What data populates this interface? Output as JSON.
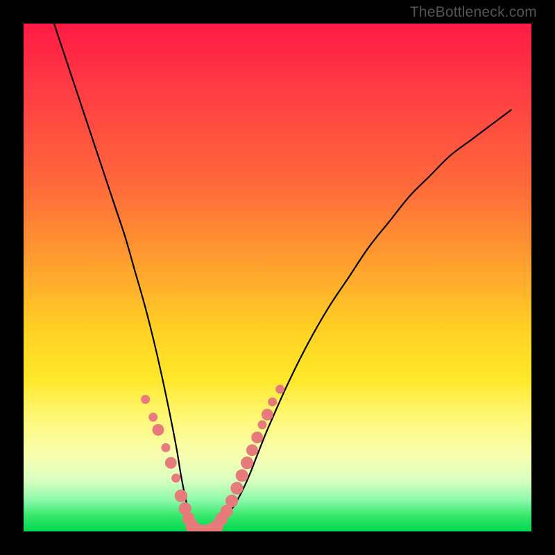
{
  "watermark": "TheBottleneck.com",
  "chart_data": {
    "type": "line",
    "title": "",
    "xlabel": "",
    "ylabel": "",
    "xlim": [
      0,
      100
    ],
    "ylim": [
      0,
      100
    ],
    "series": [
      {
        "name": "bottleneck-curve",
        "x": [
          6,
          8,
          10,
          12,
          14,
          16,
          18,
          20,
          22,
          24,
          26,
          28,
          30,
          31,
          32,
          33,
          34,
          36,
          38,
          40,
          42,
          44,
          46,
          48,
          52,
          56,
          60,
          64,
          68,
          72,
          76,
          80,
          84,
          88,
          92,
          96
        ],
        "y": [
          100,
          94,
          88,
          82,
          76,
          70,
          64,
          58,
          51,
          44,
          36,
          27,
          17,
          11,
          6,
          2,
          0,
          0,
          1,
          3,
          6,
          10,
          15,
          20,
          29,
          37,
          44,
          50,
          56,
          61,
          66,
          70,
          74,
          77,
          80,
          83
        ]
      }
    ],
    "markers": {
      "name": "highlight-dots",
      "color": "#e77a7a",
      "points": [
        {
          "x": 24.0,
          "y": 26.0,
          "r": 1.0
        },
        {
          "x": 25.5,
          "y": 22.5,
          "r": 1.0
        },
        {
          "x": 26.5,
          "y": 20.0,
          "r": 1.3
        },
        {
          "x": 28.0,
          "y": 16.5,
          "r": 1.0
        },
        {
          "x": 29.0,
          "y": 13.5,
          "r": 1.3
        },
        {
          "x": 30.0,
          "y": 10.5,
          "r": 1.0
        },
        {
          "x": 31.0,
          "y": 7.0,
          "r": 1.4
        },
        {
          "x": 31.8,
          "y": 4.5,
          "r": 1.4
        },
        {
          "x": 32.5,
          "y": 2.5,
          "r": 1.4
        },
        {
          "x": 33.2,
          "y": 1.0,
          "r": 1.5
        },
        {
          "x": 34.0,
          "y": 0.3,
          "r": 1.5
        },
        {
          "x": 35.0,
          "y": 0.0,
          "r": 1.5
        },
        {
          "x": 36.0,
          "y": 0.0,
          "r": 1.5
        },
        {
          "x": 37.0,
          "y": 0.3,
          "r": 1.5
        },
        {
          "x": 38.0,
          "y": 1.0,
          "r": 1.5
        },
        {
          "x": 39.0,
          "y": 2.5,
          "r": 1.4
        },
        {
          "x": 40.0,
          "y": 4.0,
          "r": 1.4
        },
        {
          "x": 41.0,
          "y": 6.0,
          "r": 1.4
        },
        {
          "x": 42.0,
          "y": 8.5,
          "r": 1.4
        },
        {
          "x": 43.0,
          "y": 11.0,
          "r": 1.4
        },
        {
          "x": 44.0,
          "y": 13.5,
          "r": 1.4
        },
        {
          "x": 45.0,
          "y": 16.0,
          "r": 1.3
        },
        {
          "x": 46.0,
          "y": 18.5,
          "r": 1.3
        },
        {
          "x": 47.0,
          "y": 21.0,
          "r": 1.0
        },
        {
          "x": 48.0,
          "y": 23.0,
          "r": 1.3
        },
        {
          "x": 49.0,
          "y": 25.5,
          "r": 1.0
        },
        {
          "x": 50.5,
          "y": 28.0,
          "r": 1.0
        }
      ]
    },
    "gradient_stops": [
      {
        "pos": 0,
        "color": "#ff1a44"
      },
      {
        "pos": 32,
        "color": "#ff6a3a"
      },
      {
        "pos": 60,
        "color": "#ffd024"
      },
      {
        "pos": 85,
        "color": "#f8ffb0"
      },
      {
        "pos": 100,
        "color": "#00d850"
      }
    ]
  }
}
